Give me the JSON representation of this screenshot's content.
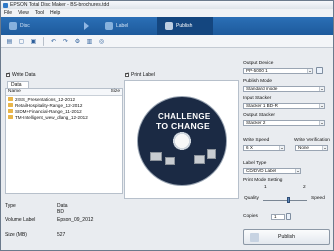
{
  "window": {
    "title": "EPSON Total Disc Maker - BS-brochures.tdd"
  },
  "menu": [
    "File",
    "View",
    "Tool",
    "Help"
  ],
  "modes": [
    {
      "label": "Disc",
      "selected": false
    },
    {
      "label": "Label",
      "selected": false
    },
    {
      "label": "Publish",
      "selected": true
    }
  ],
  "left": {
    "write_data_label": "Write Data",
    "tab_label": "Data",
    "columns": [
      "Name",
      "Size"
    ],
    "files": [
      "2ISS_Presentations_12-2012",
      "RetailHospitality-Range_12-2012",
      "SIDM+Financial-Range_11-2012",
      "TM-Intelligent_wew_dlang_12-2012"
    ],
    "info": [
      {
        "key": "Type",
        "value": "Data BD"
      },
      {
        "key": "Volume Label",
        "value": "Epson_09_2012"
      },
      {
        "key": "Size (MB)",
        "value": "527"
      }
    ]
  },
  "label": {
    "print_label": "Print Label",
    "disc_text_line1": "CHALLENGE",
    "disc_text_line2": "TO CHANGE"
  },
  "right": {
    "output_device_label": "Output Device",
    "output_device_value": "PP-5000 1",
    "publish_mode_label": "Publish Mode",
    "publish_mode_value": "Standard mode",
    "input_stacker_label": "Input Stacker",
    "input_stacker_value": "Stacker 1 BD-R",
    "output_stacker_label": "Output Stacker",
    "output_stacker_value": "Stacker 2",
    "write_speed_label": "Write Speed",
    "write_speed_value": "6 X",
    "write_verification_label": "Write Verification",
    "write_verification_value": "None",
    "label_type_label": "Label Type",
    "label_type_value": "CD/DVD Label",
    "print_mode_label": "Print Mode Setting",
    "slider_tick_1": "1",
    "slider_tick_2": "2",
    "quality_label": "Quality",
    "speed_label": "Speed",
    "copies_label": "Copies",
    "copies_value": "1",
    "publish_button": "Publish"
  }
}
